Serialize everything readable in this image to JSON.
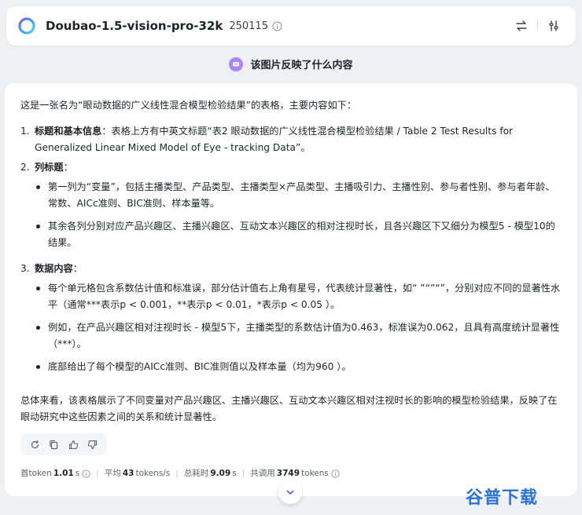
{
  "header": {
    "model_name": "Doubao-1.5-vision-pro-32k",
    "model_version": "250115"
  },
  "question": {
    "text": "该图片反映了什么内容"
  },
  "answer": {
    "intro": "这是一张名为“眼动数据的广义线性混合模型检验结果”的表格，主要内容如下：",
    "sections": [
      {
        "number": "1.",
        "heading": "标题和基本信息",
        "text": "：表格上方有中英文标题“表2 眼动数据的广义线性混合模型检验结果 / Table 2 Test Results for Generalized Linear Mixed Model of Eye - tracking Data”。"
      },
      {
        "number": "2.",
        "heading": "列标题",
        "text": "：",
        "bullets": [
          "第一列为“变量”，包括主播类型、产品类型、主播类型×产品类型、主播吸引力、主播性别、参与者性别、参与者年龄、常数、AICc准则、BIC准则、样本量等。",
          "其余各列分别对应产品兴趣区、主播兴趣区、互动文本兴趣区的相对注视时长，且各兴趣区下又细分为模型5 - 模型10的结果。"
        ]
      },
      {
        "number": "3.",
        "heading": "数据内容",
        "text": "：",
        "bullets": [
          "每个单元格包含系数估计值和标准误，部分估计值右上角有星号，代表统计显著性，如“ ”“”“”，分别对应不同的显著性水平（通常***表示p < 0.001，**表示p < 0.01，*表示p < 0.05 ）。",
          "例如，在产品兴趣区相对注视时长 - 模型5下，主播类型的系数估计值为0.463，标准误为0.062，且具有高度统计显著性（***）。",
          "底部给出了每个模型的AICc准则、BIC准则值以及样本量（均为960 ）。"
        ]
      }
    ],
    "summary": "总体来看，该表格展示了不同变量对产品兴趣区、主播兴趣区、互动文本兴趣区相对注视时长的影响的模型检验结果，反映了在眼动研究中这些因素之间的关系和统计显著性。"
  },
  "stats": {
    "first_token_label": "首token",
    "first_token_value": "1.01",
    "first_token_unit": "s",
    "avg_label": "平均",
    "avg_value": "43",
    "avg_unit": "tokens/s",
    "total_label": "总耗时",
    "total_value": "9.09",
    "total_unit": "s",
    "calls_label": "共调用",
    "calls_value": "3749",
    "calls_unit": "tokens"
  },
  "watermark": {
    "text": "谷普下载"
  },
  "colors": {
    "accent": "#6b4ef6",
    "question_icon": "#a486ff",
    "watermark": "#2a73d9"
  }
}
